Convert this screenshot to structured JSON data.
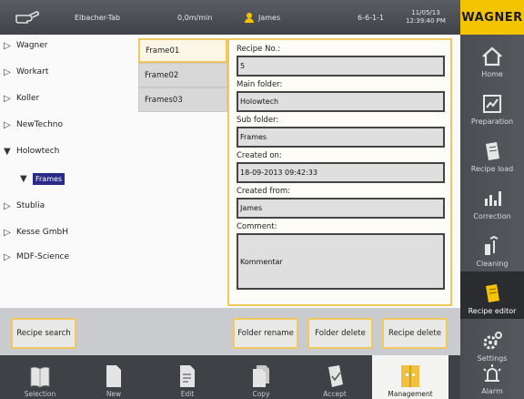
{
  "header": {
    "tab": "Elbacher-Tab",
    "speed": "0,0m/min",
    "user": "James",
    "code": "6-6-1-1",
    "date": "11/05/13",
    "time": "12:39:40 PM",
    "brand": "WAGNER"
  },
  "sidebar": [
    {
      "label": "Home",
      "icon": "home-icon"
    },
    {
      "label": "Preparation",
      "icon": "preparation-icon"
    },
    {
      "label": "Recipe load",
      "icon": "recipe-load-icon"
    },
    {
      "label": "Correction",
      "icon": "correction-icon"
    },
    {
      "label": "Cleaning",
      "icon": "cleaning-icon"
    },
    {
      "label": "Recipe editor",
      "icon": "recipe-editor-icon"
    },
    {
      "label": "Settings",
      "icon": "settings-icon"
    },
    {
      "label": "Alarm",
      "icon": "alarm-icon"
    }
  ],
  "tree": [
    {
      "label": "Wagner",
      "expanded": false
    },
    {
      "label": "Workart",
      "expanded": false
    },
    {
      "label": "Koller",
      "expanded": false
    },
    {
      "label": "NewTechno",
      "expanded": false
    },
    {
      "label": "Holowtech",
      "expanded": true
    },
    {
      "label": "Frames",
      "selected": true,
      "sub": true
    },
    {
      "label": "Stublia",
      "expanded": false
    },
    {
      "label": "Kesse GmbH",
      "expanded": false
    },
    {
      "label": "MDF-Science",
      "expanded": false
    }
  ],
  "frames": [
    "Frame01",
    "Frame02",
    "Frames03"
  ],
  "details": {
    "recipe_no_label": "Recipe No.:",
    "recipe_no": "5",
    "main_folder_label": "Main folder:",
    "main_folder": "Holowtech",
    "sub_folder_label": "Sub folder:",
    "sub_folder": "Frames",
    "created_on_label": "Created on:",
    "created_on": "18-09-2013 09:42:33",
    "created_from_label": "Created from:",
    "created_from": "James",
    "comment_label": "Comment:",
    "comment": "Kommentar"
  },
  "actions": {
    "recipe_search": "Recipe search",
    "folder_rename": "Folder rename",
    "folder_delete": "Folder delete",
    "recipe_delete": "Recipe delete"
  },
  "bottom": [
    {
      "label": "Selection",
      "icon": "book-icon"
    },
    {
      "label": "New",
      "icon": "new-doc-icon"
    },
    {
      "label": "Edit",
      "icon": "edit-doc-icon"
    },
    {
      "label": "Copy",
      "icon": "copy-icon"
    },
    {
      "label": "Accept",
      "icon": "accept-icon"
    },
    {
      "label": "Management",
      "icon": "management-icon"
    }
  ],
  "colors": {
    "accent": "#f0c860",
    "brand": "#f5c400",
    "selection": "#2a2a8a"
  }
}
